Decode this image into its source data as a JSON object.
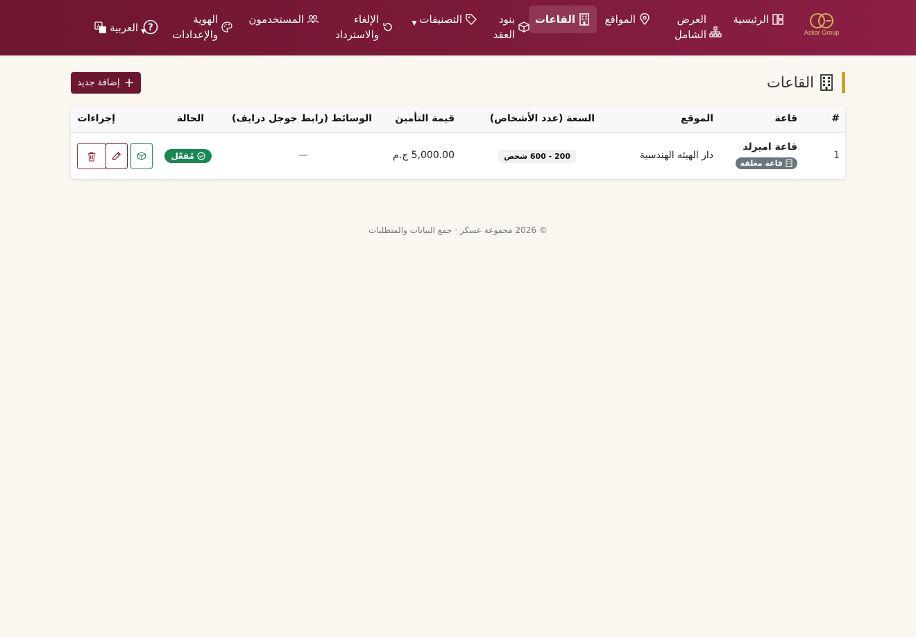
{
  "brand": {
    "logo_text": "Askar Group"
  },
  "nav": {
    "home": "الرئيسية",
    "overview": "العرض الشامل",
    "locations": "المواقع",
    "halls": "القاعات",
    "contract_terms": "بنود العقد",
    "categories": "التصنيفات",
    "cancel_refund": "الإلغاء والاسترداد",
    "users": "المستخدمون",
    "identity_settings": "الهوية والإعدادات",
    "language": "العربية"
  },
  "page": {
    "title": "القاعات",
    "add_button": "إضافة جديد"
  },
  "table": {
    "headers": {
      "index": "#",
      "hall": "قاعة",
      "location": "الموقع",
      "capacity": "السعة (عدد الأشخاص)",
      "deposit": "قيمة التأمين",
      "media": "الوسائط (رابط جوجل درايف)",
      "status": "الحالة",
      "actions": "إجراءات"
    },
    "rows": [
      {
        "index": "1",
        "hall": "قاعة اميرلد",
        "hall_type": "قاعة مغلقة",
        "location": "دار الهيئه الهندسية",
        "capacity": "200 - 600 شخص",
        "deposit": "5,000.00 ج.م",
        "media": "—",
        "status": "مُفعّل"
      }
    ]
  },
  "footer": {
    "text": "© 2026 مجموعة عسكر · جمع البيانات والمتطلبات"
  },
  "colors": {
    "primary": "#6b1730",
    "accent": "#c9a227",
    "success": "#198754",
    "danger": "#a12a3a"
  }
}
